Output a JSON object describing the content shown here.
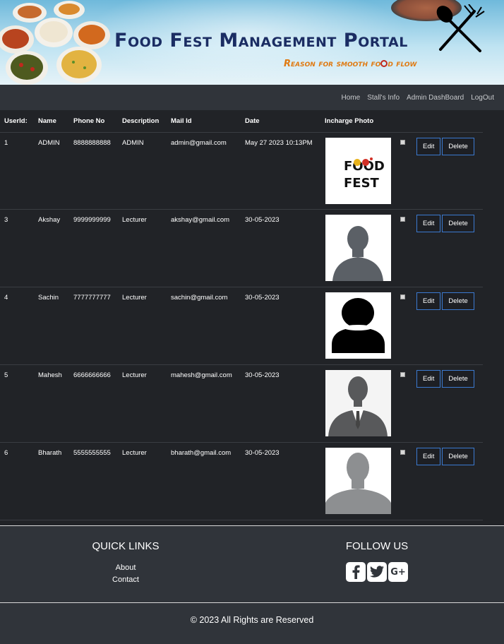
{
  "header": {
    "title": "Food Fest Management Portal",
    "subtitle_before": "Reason for smooth fo",
    "subtitle_after": "d flow"
  },
  "nav": {
    "items": [
      {
        "label": "Home"
      },
      {
        "label": "Stall's Info"
      },
      {
        "label": "Admin DashBoard"
      },
      {
        "label": "LogOut"
      }
    ]
  },
  "table": {
    "headers": [
      "UserId:",
      "Name",
      "Phone No",
      "Description",
      "Mail Id",
      "Date",
      "Incharge Photo"
    ],
    "edit_label": "Edit",
    "delete_label": "Delete",
    "rows": [
      {
        "id": "1",
        "name": "ADMIN",
        "phone": "8888888888",
        "description": "ADMIN",
        "mail": "admin@gmail.com",
        "date": "May 27 2023 10:13PM",
        "photo": "food-fest-logo",
        "food_text": "FOOD",
        "fest_text": "FEST"
      },
      {
        "id": "3",
        "name": "Akshay",
        "phone": "9999999999",
        "description": "Lecturer",
        "mail": "akshay@gmail.com",
        "date": "30-05-2023",
        "photo": "person-silhouette-dark"
      },
      {
        "id": "4",
        "name": "Sachin",
        "phone": "7777777777",
        "description": "Lecturer",
        "mail": "sachin@gmail.com",
        "date": "30-05-2023",
        "photo": "person-icon-black"
      },
      {
        "id": "5",
        "name": "Mahesh",
        "phone": "6666666666",
        "description": "Lecturer",
        "mail": "mahesh@gmail.com",
        "date": "30-05-2023",
        "photo": "person-suit-silhouette"
      },
      {
        "id": "6",
        "name": "Bharath",
        "phone": "5555555555",
        "description": "Lecturer",
        "mail": "bharath@gmail.com",
        "date": "30-05-2023",
        "photo": "person-silhouette-grey"
      }
    ]
  },
  "footer": {
    "quick_links_title": "QUICK LINKS",
    "links": [
      {
        "label": "About"
      },
      {
        "label": "Contact"
      }
    ],
    "follow_title": "FOLLOW US",
    "social_icons": [
      "facebook-icon",
      "twitter-icon",
      "google-plus-icon"
    ],
    "google_plus_text": "G+",
    "copyright": "© 2023 All Rights are Reserved"
  },
  "colors": {
    "background": "#212327",
    "navbar": "#30343a",
    "title": "#1b2d63",
    "subtitle": "#e07a12",
    "button_border": "#3b7ad1"
  }
}
